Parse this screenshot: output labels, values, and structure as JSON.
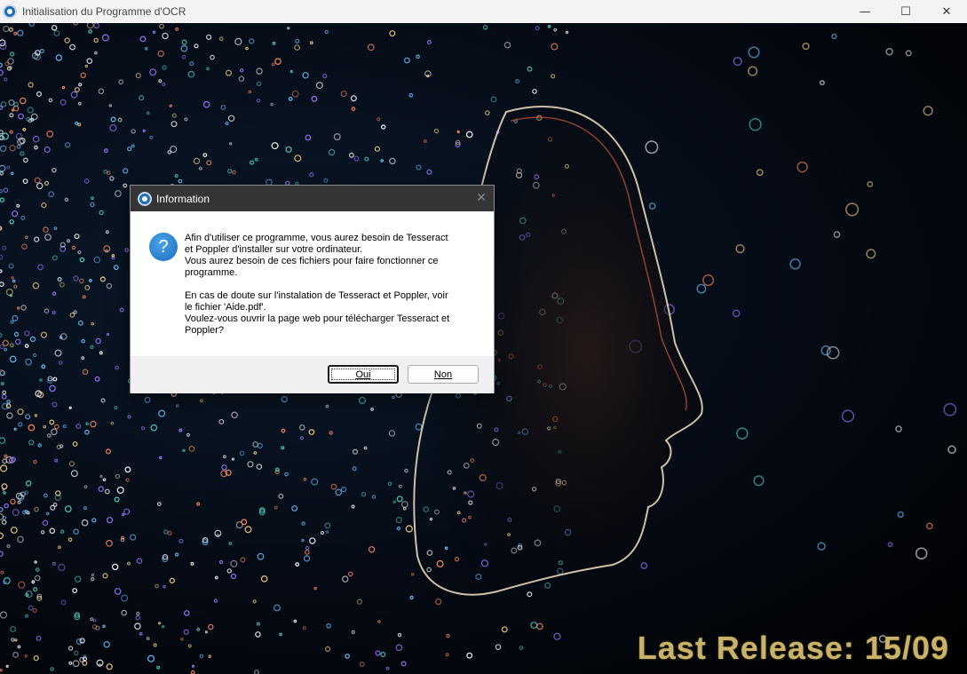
{
  "window": {
    "title": "Initialisation du Programme d'OCR",
    "controls": {
      "minimize": "—",
      "maximize": "☐",
      "close": "✕"
    }
  },
  "background": {
    "release_text": "Last Release: 15/09",
    "release_color": "#c9b36a"
  },
  "dialog": {
    "title": "Information",
    "close_glyph": "✕",
    "icon": "question-icon",
    "icon_glyph": "?",
    "message": "Afin d'utiliser ce programme, vous aurez besoin de Tesseract\net Poppler d'installer sur votre ordinateur.\nVous aurez besoin de ces fichiers pour faire fonctionner ce\nprogramme.\n\nEn cas de doute sur l'instalation de Tesseract et Poppler, voir\nle fichier 'Aide.pdf'.\n Voulez-vous ouvrir la page web pour télécharger Tesseract et\nPoppler?",
    "buttons": {
      "yes": "Oui",
      "no": "Non"
    }
  }
}
